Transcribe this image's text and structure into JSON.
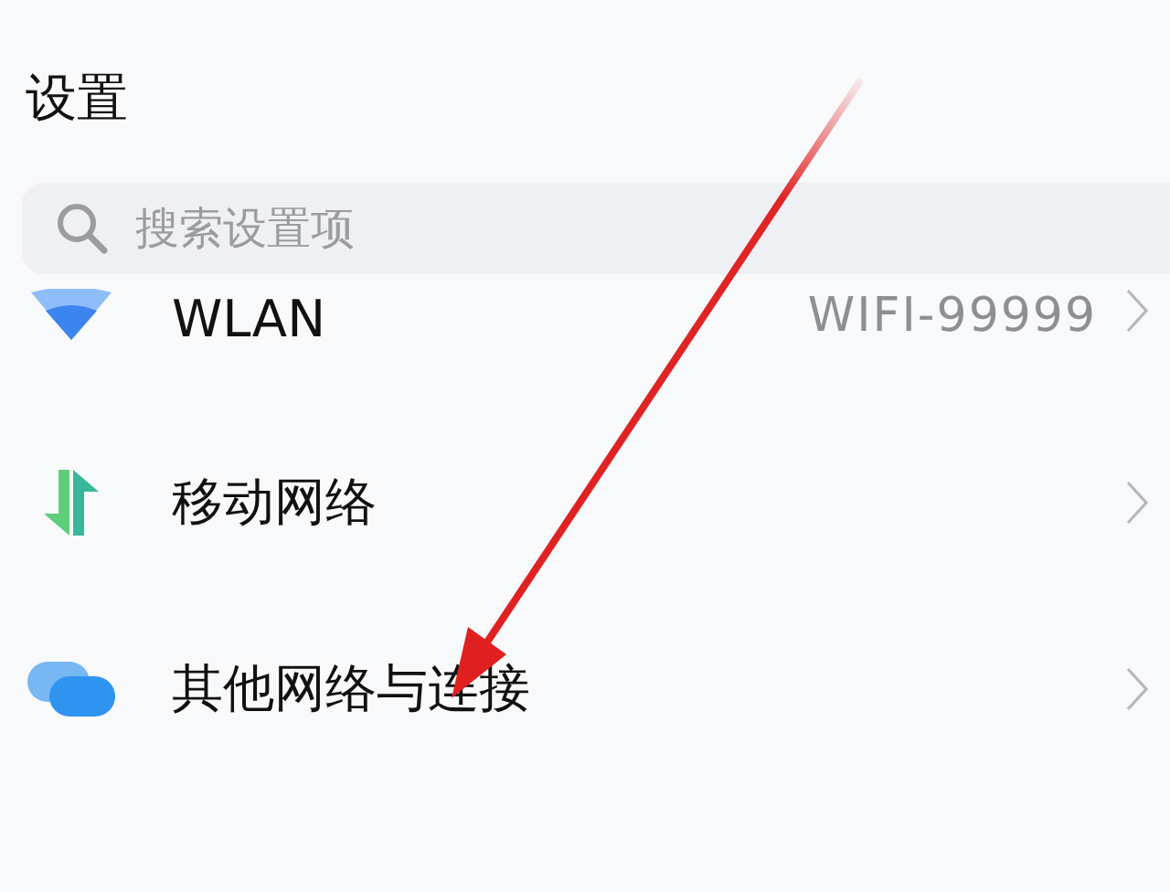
{
  "title": "设置",
  "search": {
    "placeholder": "搜索设置项"
  },
  "rows": [
    {
      "kind": "wifi",
      "label": "WLAN",
      "value": "WIFI-99999"
    },
    {
      "kind": "mobile",
      "label": "移动网络"
    },
    {
      "kind": "connections",
      "label": "其他网络与连接"
    }
  ]
}
